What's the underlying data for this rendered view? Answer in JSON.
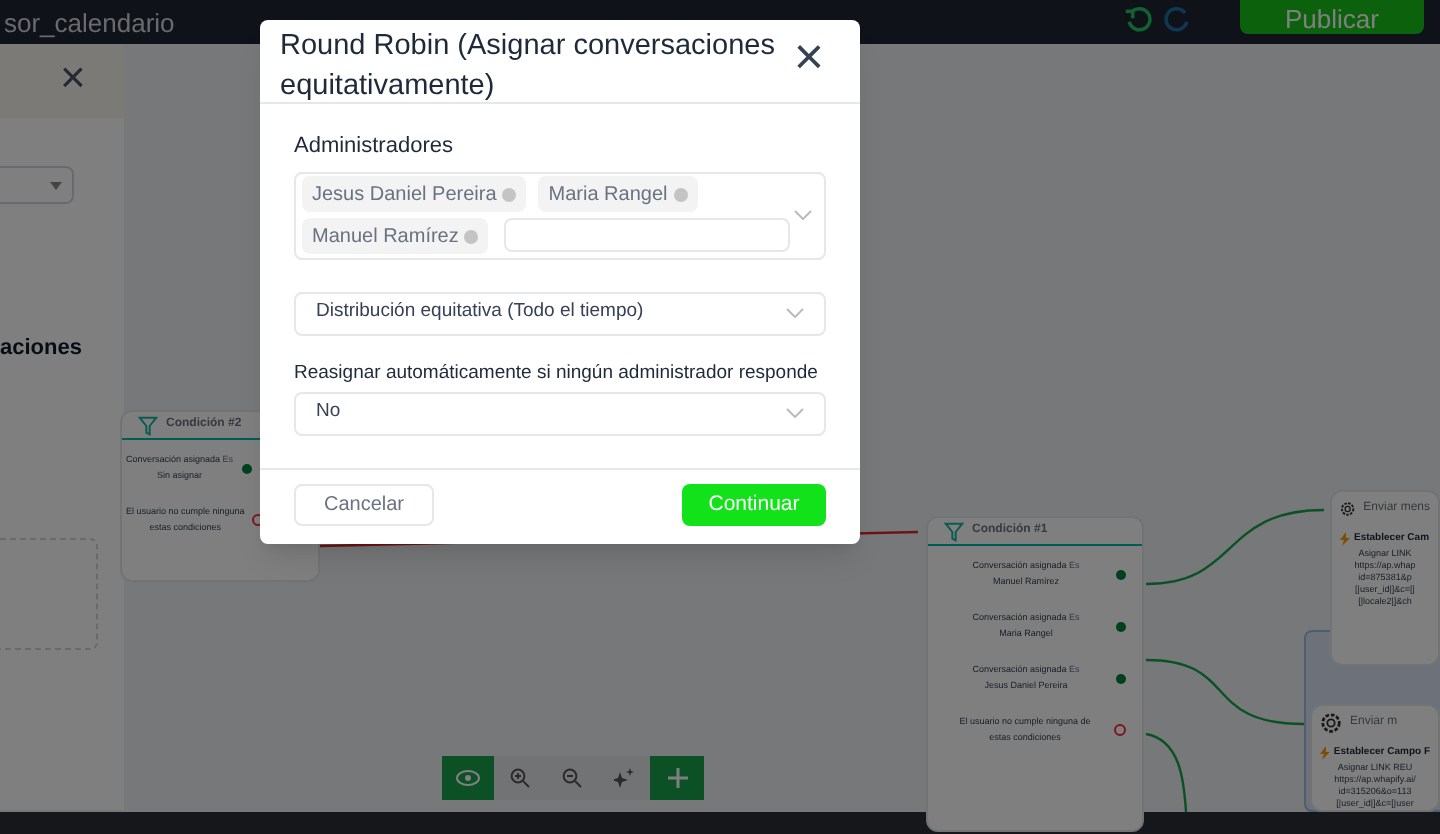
{
  "top_bar": {
    "title": "sor_calendario",
    "publish_button": "Publicar"
  },
  "side_panel": {
    "close": "×",
    "heading": "aciones"
  },
  "canvas": {
    "nodes": [
      {
        "kind": "condition",
        "title": "Condición #2",
        "rows": [
          {
            "text": "Conversación asignada",
            "op": "Es",
            "value": "Sin asignar",
            "kind": "match"
          },
          {
            "text": "El usuario no cumple ninguna",
            "value": "estas condiciones",
            "kind": "fallback"
          }
        ]
      },
      {
        "kind": "condition",
        "title": "Condición #1",
        "rows": [
          {
            "text": "Conversación asignada",
            "op": "Es",
            "value": "Manuel Ramírez",
            "kind": "match"
          },
          {
            "text": "Conversación asignada",
            "op": "Es",
            "value": "Maria Rangel",
            "kind": "match"
          },
          {
            "text": "Conversación asignada",
            "op": "Es",
            "value": "Jesus Daniel Pereira",
            "kind": "match"
          },
          {
            "text": "El usuario no cumple ninguna de",
            "value": "estas condiciones",
            "kind": "fallback"
          }
        ]
      },
      {
        "kind": "message",
        "title": "Enviar mens",
        "action": "Establecer Cam",
        "lines": [
          "Asignar LINK",
          "https://ap.whap",
          "id=875381&p",
          "[|user_id|]&c=[|",
          "[|locale2|]&ch"
        ]
      },
      {
        "kind": "message",
        "title": "Enviar m",
        "action": "Establecer Campo F",
        "lines": [
          "Asignar LINK REU",
          "https://ap.whapify.ai/",
          "id=315206&o=113",
          "[|user_id|]&c=[|user"
        ]
      }
    ]
  },
  "modal": {
    "title": "Round Robin (Asignar conversaciones equitativamente)",
    "close": "×",
    "admins_label": "Administradores",
    "admins": [
      {
        "label": "Jesus Daniel Pereira"
      },
      {
        "label": "Maria Rangel"
      },
      {
        "label": "Manuel Ramírez"
      }
    ],
    "distribution": {
      "value": "Distribución equitativa (Todo el tiempo)"
    },
    "reassign_label": "Reasignar automáticamente si ningún administrador responde",
    "reassign": {
      "value": "No"
    },
    "cancel": "Cancelar",
    "continue": "Continuar"
  }
}
